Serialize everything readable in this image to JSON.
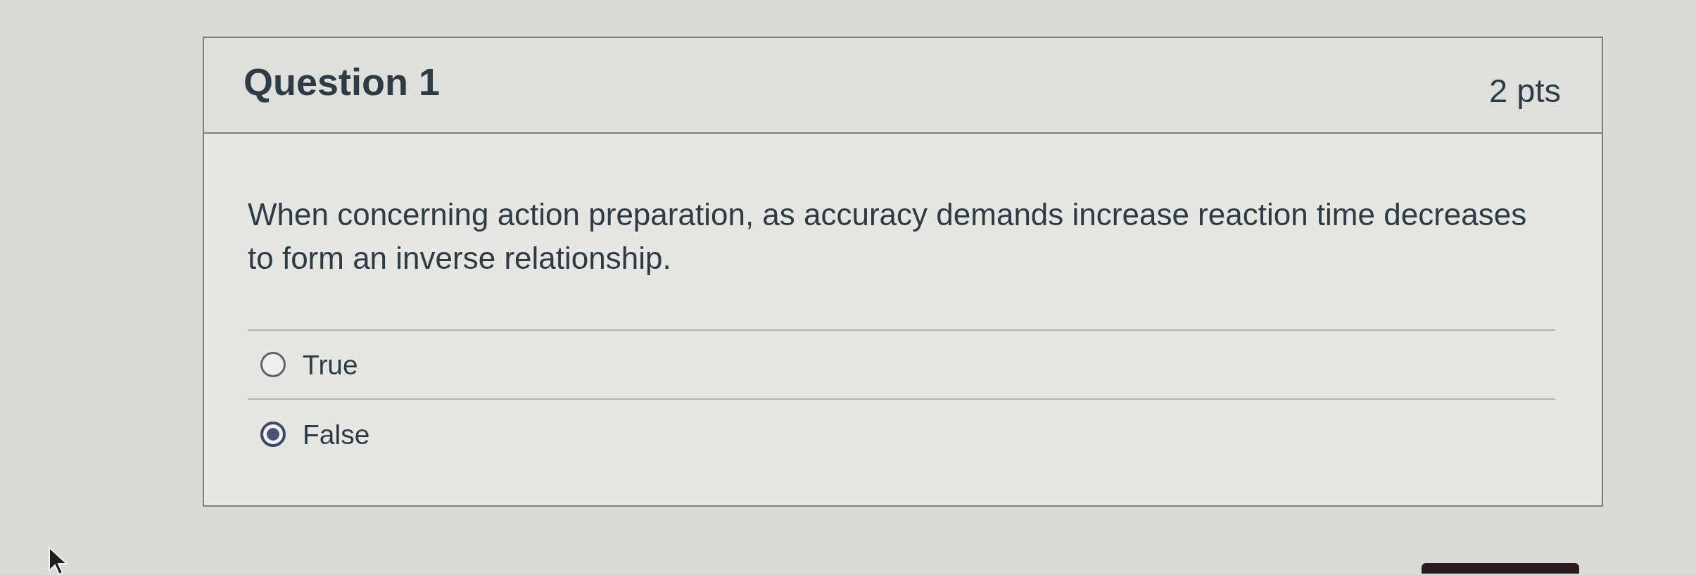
{
  "question": {
    "title": "Question 1",
    "points": "2 pts",
    "text": "When concerning action preparation, as accuracy demands increase reaction time decreases to form an inverse relationship.",
    "answers": [
      {
        "label": "True",
        "selected": false
      },
      {
        "label": "False",
        "selected": true
      }
    ]
  }
}
